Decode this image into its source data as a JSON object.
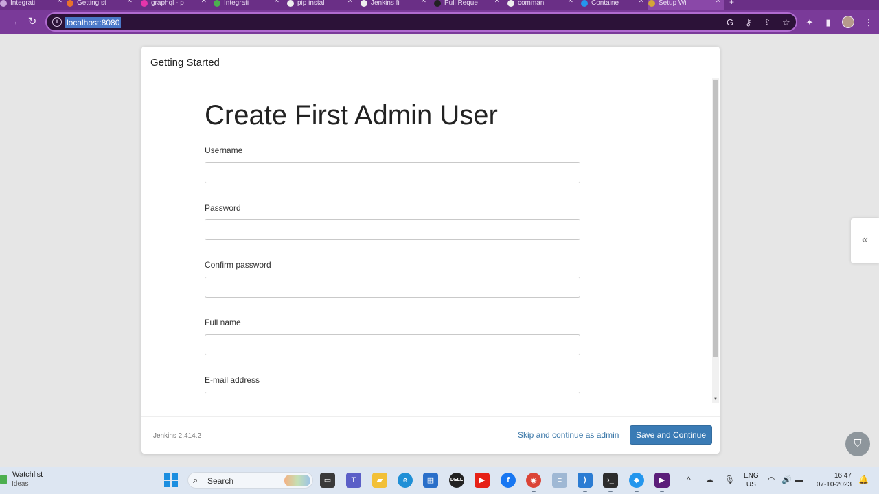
{
  "browser": {
    "tabs": [
      {
        "label": "Integrati"
      },
      {
        "label": "Getting st"
      },
      {
        "label": "graphql - p"
      },
      {
        "label": "Integrati"
      },
      {
        "label": "pip instal"
      },
      {
        "label": "Jenkins fi"
      },
      {
        "label": "Pull Reque"
      },
      {
        "label": "comman"
      },
      {
        "label": "Containe"
      },
      {
        "label": "Setup Wi"
      }
    ],
    "url": "localhost:8080"
  },
  "dialog": {
    "title": "Getting Started",
    "heading": "Create First Admin User",
    "fields": {
      "username_label": "Username",
      "password_label": "Password",
      "confirm_label": "Confirm password",
      "fullname_label": "Full name",
      "email_label": "E-mail address"
    },
    "version": "Jenkins 2.414.2",
    "skip_label": "Skip and continue as admin",
    "save_label": "Save and Continue",
    "colors": {
      "primary": "#3a7bb5",
      "link": "#3a77a8"
    }
  },
  "taskbar": {
    "widget_title": "Watchlist",
    "widget_sub": "Ideas",
    "search_label": "Search",
    "lang_line1": "ENG",
    "lang_line2": "US",
    "time": "16:47",
    "date": "07-10-2023"
  }
}
